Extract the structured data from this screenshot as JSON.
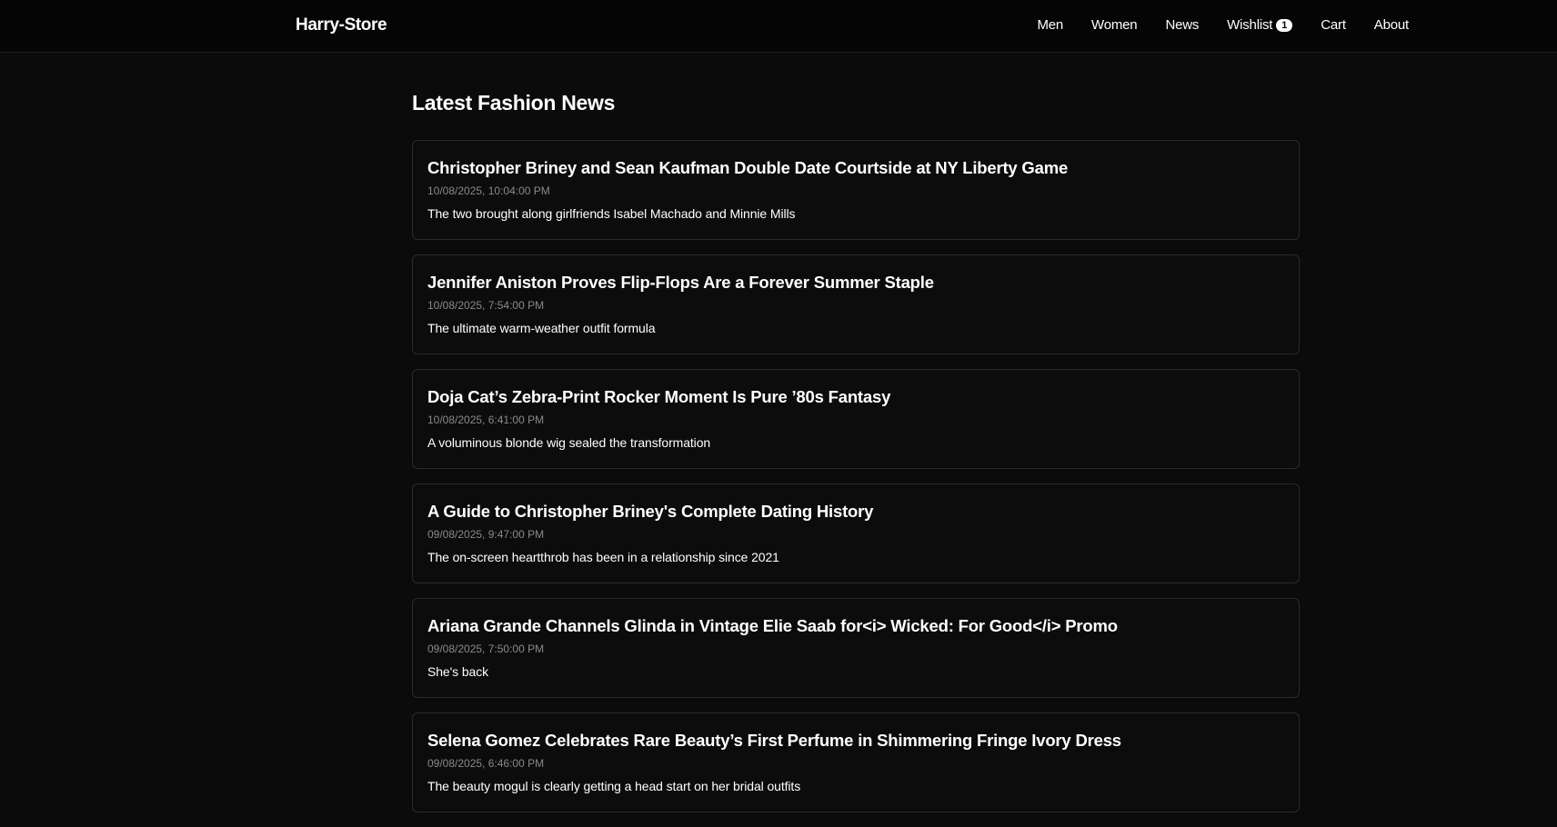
{
  "nav": {
    "brand": "Harry-Store",
    "links": {
      "men": "Men",
      "women": "Women",
      "news": "News",
      "wishlist": "Wishlist",
      "wishlist_count": "1",
      "cart": "Cart",
      "about": "About"
    }
  },
  "page": {
    "title": "Latest Fashion News"
  },
  "articles": [
    {
      "title": "Christopher Briney and Sean Kaufman Double Date Courtside at NY Liberty Game",
      "date": "10/08/2025, 10:04:00 PM",
      "summary": "The two brought along girlfriends Isabel Machado and Minnie Mills"
    },
    {
      "title": "Jennifer Aniston Proves Flip-Flops Are a Forever Summer Staple",
      "date": "10/08/2025, 7:54:00 PM",
      "summary": "The ultimate warm-weather outfit formula"
    },
    {
      "title": "Doja Cat’s Zebra-Print Rocker Moment Is Pure ’80s Fantasy",
      "date": "10/08/2025, 6:41:00 PM",
      "summary": "A voluminous blonde wig sealed the transformation"
    },
    {
      "title": "A Guide to Christopher Briney's Complete Dating History",
      "date": "09/08/2025, 9:47:00 PM",
      "summary": "The on-screen heartthrob has been in a relationship since 2021"
    },
    {
      "title": "Ariana Grande Channels Glinda in Vintage Elie Saab for<i> Wicked: For Good</i> Promo",
      "date": "09/08/2025, 7:50:00 PM",
      "summary": "She's back"
    },
    {
      "title": "Selena Gomez Celebrates Rare Beauty’s First Perfume in Shimmering Fringe Ivory Dress",
      "date": "09/08/2025, 6:46:00 PM",
      "summary": "The beauty mogul is clearly getting a head start on her bridal outfits"
    }
  ]
}
